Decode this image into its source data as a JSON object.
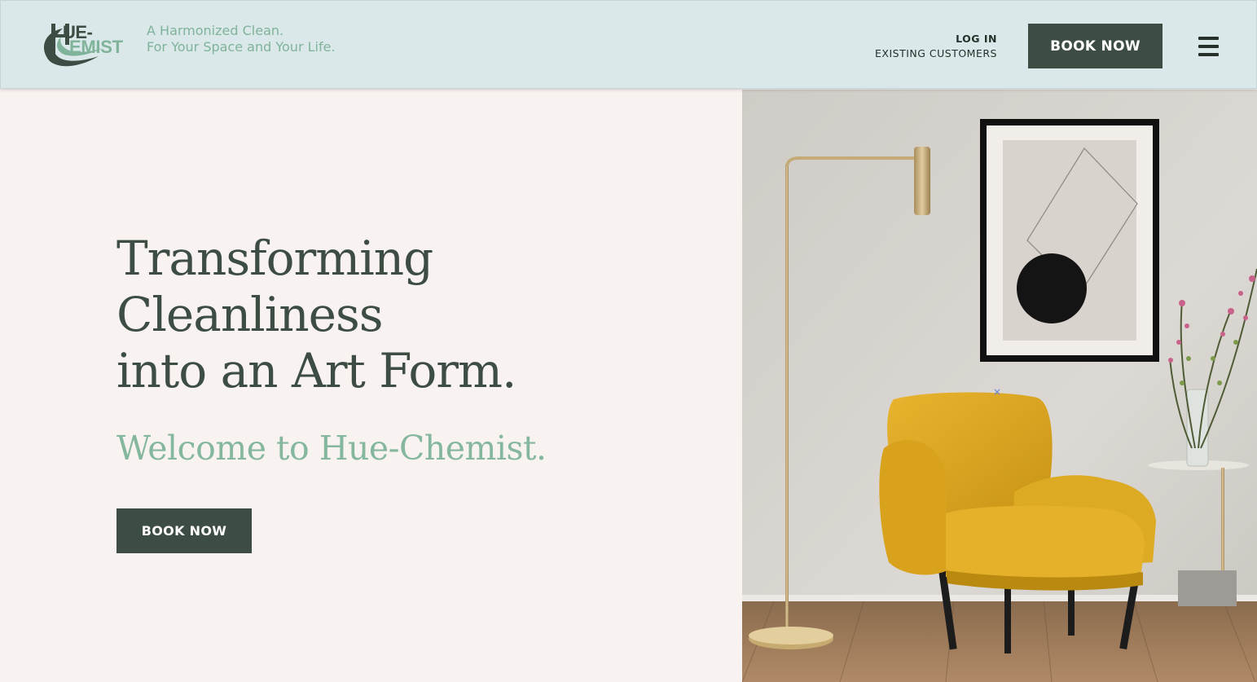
{
  "brand": {
    "logo_line_1": "UE-",
    "logo_line_2": "EMIST",
    "tagline_line_1": "A Harmonized Clean.",
    "tagline_line_2": "For Your Space and Your Life.",
    "primary_color": "#3e4d44",
    "accent_color": "#7fb39a"
  },
  "header": {
    "login_label": "LOG IN",
    "login_sublabel": "EXISTING CUSTOMERS",
    "book_button": "BOOK NOW",
    "menu_icon": "hamburger-menu-icon"
  },
  "hero": {
    "headline_lines": [
      "Transforming",
      "Cleanliness",
      "into an Art Form."
    ],
    "welcome": "Welcome to Hue-Chemist.",
    "book_button": "BOOK NOW",
    "image_subject": "yellow-armchair-room-photo"
  }
}
